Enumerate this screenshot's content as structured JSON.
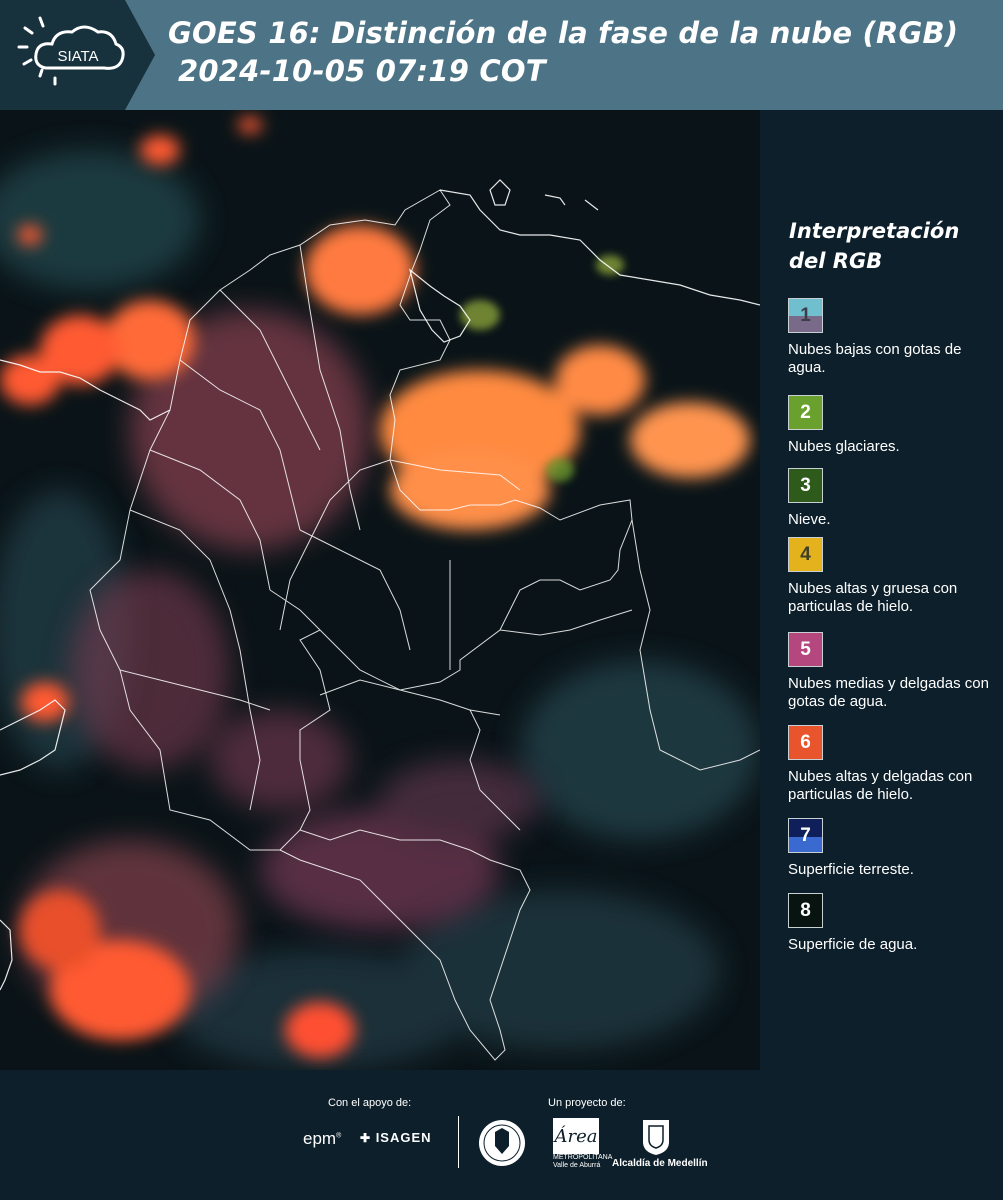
{
  "header": {
    "logo_text": "SIATA",
    "title_line1": "GOES 16: Distinción de la fase de la nube (RGB)",
    "title_line2": "2024-10-05 07:19 COT",
    "background_color": "#4d7486"
  },
  "legend": {
    "title": "Interpretación del RGB",
    "items": [
      {
        "number": "1",
        "label": "Nubes bajas con gotas de agua.",
        "color_top": "#6fbfcf",
        "color_bottom": "#7a6a8a"
      },
      {
        "number": "2",
        "label": "Nubes glaciares.",
        "color_top": "#6aa12e",
        "color_bottom": "#6aa12e"
      },
      {
        "number": "3",
        "label": "Nieve.",
        "color_top": "#2e5a1c",
        "color_bottom": "#2e5a1c"
      },
      {
        "number": "4",
        "label": "Nubes altas y gruesa con particulas de hielo.",
        "color_top": "#e3b21c",
        "color_bottom": "#e3b21c"
      },
      {
        "number": "5",
        "label": "Nubes medias y delgadas con gotas de agua.",
        "color_top": "#b3477e",
        "color_bottom": "#b3477e"
      },
      {
        "number": "6",
        "label": "Nubes altas y delgadas con particulas de hielo.",
        "color_top": "#e8542c",
        "color_bottom": "#e8542c"
      },
      {
        "number": "7",
        "label": "Superficie terreste.",
        "color_top": "#0e1f5a",
        "color_bottom": "#3a6ad0"
      },
      {
        "number": "8",
        "label": "Superficie de agua.",
        "color_top": "#081410",
        "color_bottom": "#081410"
      }
    ]
  },
  "footer": {
    "support_label": "Con el apoyo de:",
    "project_label": "Un proyecto de:",
    "sponsor_1": "epm",
    "sponsor_2": "ISAGEN",
    "partner_metro": "METROPOLITANA Valle de Aburrá",
    "partner_alcaldia": "Alcaldía de Medellín"
  }
}
